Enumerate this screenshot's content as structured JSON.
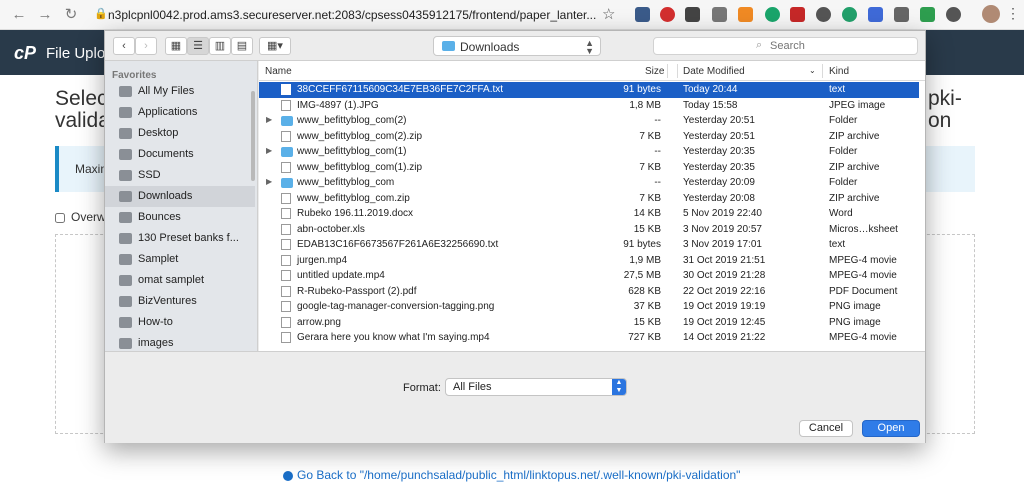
{
  "browser": {
    "url": "n3plcpnl0042.prod.ams3.secureserver.net:2083/cpsess0435912175/frontend/paper_lanter...",
    "back_icon": "arrow-left",
    "forward_icon": "arrow-right",
    "reload_icon": "reload",
    "star_icon": "star"
  },
  "cpanel": {
    "logo": "cP",
    "title": "File Uplo"
  },
  "page": {
    "heading_line1": "Select",
    "heading_line2": "validat",
    "heading_right_line1": "pki-",
    "heading_right_line2": "on",
    "info_text": "Maxim",
    "overwrite_label": "Overw",
    "go_back": "Go Back to \"/home/punchsalad/public_html/linktopus.net/.well-known/pki-validation\""
  },
  "dialog": {
    "location": "Downloads",
    "search_placeholder": "Search",
    "sidebar": {
      "header": "Favorites",
      "items": [
        {
          "label": "All My Files",
          "selected": false
        },
        {
          "label": "Applications",
          "selected": false
        },
        {
          "label": "Desktop",
          "selected": false
        },
        {
          "label": "Documents",
          "selected": false
        },
        {
          "label": "SSD",
          "selected": false
        },
        {
          "label": "Downloads",
          "selected": true
        },
        {
          "label": "Bounces",
          "selected": false
        },
        {
          "label": "130 Preset banks f...",
          "selected": false
        },
        {
          "label": "Samplet",
          "selected": false
        },
        {
          "label": "omat samplet",
          "selected": false
        },
        {
          "label": "BizVentures",
          "selected": false
        },
        {
          "label": "How-to",
          "selected": false
        },
        {
          "label": "images",
          "selected": false
        }
      ]
    },
    "columns": {
      "name": "Name",
      "size": "Size",
      "date": "Date Modified",
      "kind": "Kind"
    },
    "files": [
      {
        "name": "38CCEFF67115609C34E7EB36FE7C2FFA.txt",
        "size": "91 bytes",
        "date": "Today 20:44",
        "kind": "text",
        "folder": false,
        "selected": true
      },
      {
        "name": "IMG-4897 (1).JPG",
        "size": "1,8 MB",
        "date": "Today 15:58",
        "kind": "JPEG image",
        "folder": false,
        "selected": false
      },
      {
        "name": "www_befittyblog_com(2)",
        "size": "--",
        "date": "Yesterday 20:51",
        "kind": "Folder",
        "folder": true,
        "selected": false
      },
      {
        "name": "www_befittyblog_com(2).zip",
        "size": "7 KB",
        "date": "Yesterday 20:51",
        "kind": "ZIP archive",
        "folder": false,
        "selected": false
      },
      {
        "name": "www_befittyblog_com(1)",
        "size": "--",
        "date": "Yesterday 20:35",
        "kind": "Folder",
        "folder": true,
        "selected": false
      },
      {
        "name": "www_befittyblog_com(1).zip",
        "size": "7 KB",
        "date": "Yesterday 20:35",
        "kind": "ZIP archive",
        "folder": false,
        "selected": false
      },
      {
        "name": "www_befittyblog_com",
        "size": "--",
        "date": "Yesterday 20:09",
        "kind": "Folder",
        "folder": true,
        "selected": false
      },
      {
        "name": "www_befittyblog_com.zip",
        "size": "7 KB",
        "date": "Yesterday 20:08",
        "kind": "ZIP archive",
        "folder": false,
        "selected": false
      },
      {
        "name": "Rubeko 196.11.2019.docx",
        "size": "14 KB",
        "date": "5 Nov 2019 22:40",
        "kind": "Word",
        "folder": false,
        "selected": false
      },
      {
        "name": "abn-october.xls",
        "size": "15 KB",
        "date": "3 Nov 2019 20:57",
        "kind": "Micros…ksheet",
        "folder": false,
        "selected": false
      },
      {
        "name": "EDAB13C16F6673567F261A6E32256690.txt",
        "size": "91 bytes",
        "date": "3 Nov 2019 17:01",
        "kind": "text",
        "folder": false,
        "selected": false
      },
      {
        "name": "jurgen.mp4",
        "size": "1,9 MB",
        "date": "31 Oct 2019 21:51",
        "kind": "MPEG-4 movie",
        "folder": false,
        "selected": false
      },
      {
        "name": "untitled update.mp4",
        "size": "27,5 MB",
        "date": "30 Oct 2019 21:28",
        "kind": "MPEG-4 movie",
        "folder": false,
        "selected": false
      },
      {
        "name": "R-Rubeko-Passport (2).pdf",
        "size": "628 KB",
        "date": "22 Oct 2019 22:16",
        "kind": "PDF Document",
        "folder": false,
        "selected": false
      },
      {
        "name": "google-tag-manager-conversion-tagging.png",
        "size": "37 KB",
        "date": "19 Oct 2019 19:19",
        "kind": "PNG image",
        "folder": false,
        "selected": false
      },
      {
        "name": "arrow.png",
        "size": "15 KB",
        "date": "19 Oct 2019 12:45",
        "kind": "PNG image",
        "folder": false,
        "selected": false
      },
      {
        "name": "Gerara here you know what I'm saying.mp4",
        "size": "727 KB",
        "date": "14 Oct 2019 21:22",
        "kind": "MPEG-4 movie",
        "folder": false,
        "selected": false
      }
    ],
    "format_label": "Format:",
    "format_value": "All Files",
    "cancel_label": "Cancel",
    "open_label": "Open"
  }
}
